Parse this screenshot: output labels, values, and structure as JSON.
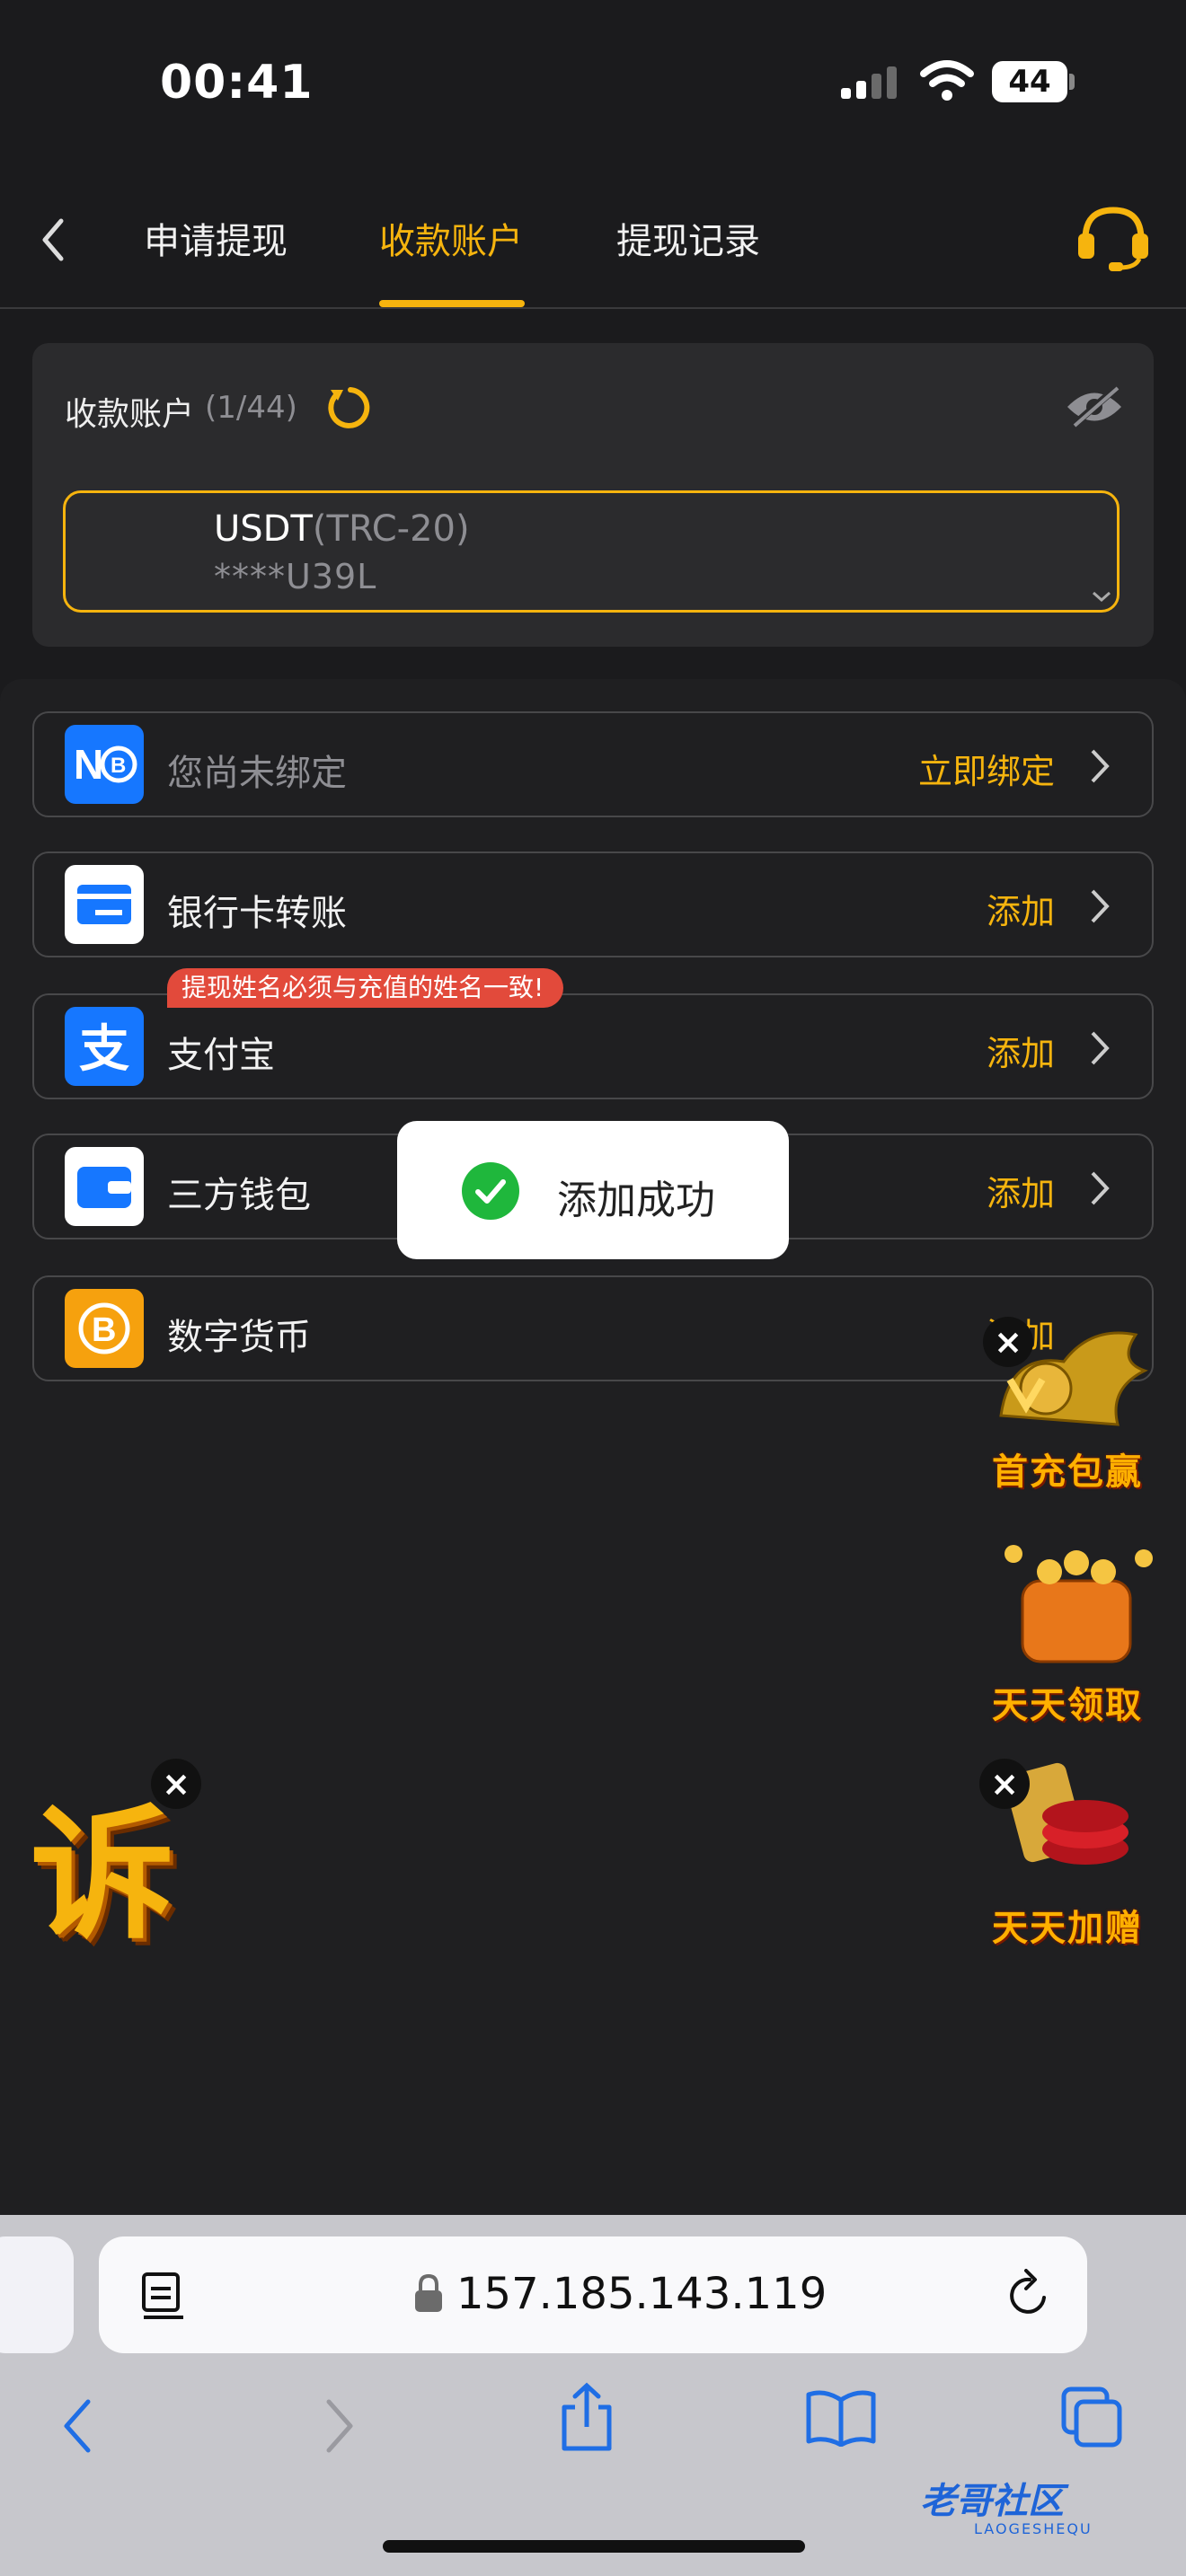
{
  "status_bar": {
    "time": "00:41",
    "battery": "44"
  },
  "nav": {
    "tabs": [
      {
        "label": "申请提现",
        "active": false
      },
      {
        "label": "收款账户",
        "active": true
      },
      {
        "label": "提现记录",
        "active": false
      }
    ]
  },
  "account": {
    "title": "收款账户",
    "count": "(1/44)",
    "selected_name": "USDT",
    "selected_network": "(TRC-20)",
    "selected_masked": "****U39L"
  },
  "methods": [
    {
      "label": "您尚未绑定",
      "action": "立即绑定",
      "icon": "nob-icon"
    },
    {
      "label": "银行卡转账",
      "action": "添加",
      "icon": "bank-card-icon"
    },
    {
      "label": "支付宝",
      "action": "添加",
      "icon": "alipay-icon"
    },
    {
      "label": "三方钱包",
      "action": "添加",
      "icon": "wallet-icon"
    },
    {
      "label": "数字货币",
      "action": "添加",
      "icon": "bitcoin-icon"
    }
  ],
  "tip_badge": "提现姓名必须与充值的姓名一致!",
  "toast": {
    "text": "添加成功"
  },
  "promos": {
    "first_deposit": "首充包赢",
    "daily_claim": "天天领取",
    "daily_bonus": "天天加赠",
    "complaint_char": "诉"
  },
  "browser": {
    "url": "157.185.143.119"
  },
  "watermark": {
    "main": "老哥社区",
    "sub": "LAOGESHEQU"
  },
  "colors": {
    "accent": "#f6b40e",
    "background": "#1b1b1d",
    "badge": "#e24a3b",
    "success": "#1fb73c"
  }
}
